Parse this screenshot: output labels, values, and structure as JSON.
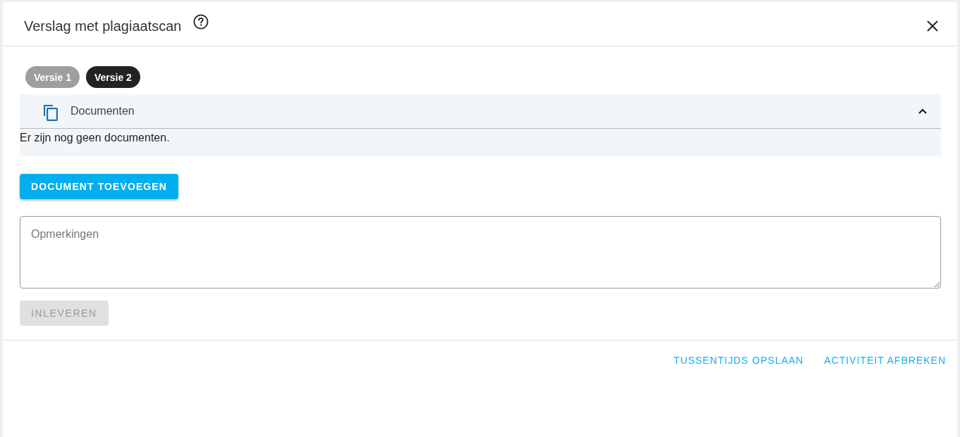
{
  "dialog": {
    "title": "Verslag met plagiaatscan"
  },
  "versions": [
    {
      "label": "Versie 1",
      "selected": false
    },
    {
      "label": "Versie 2",
      "selected": true
    }
  ],
  "documents_panel": {
    "title": "Documenten",
    "expanded": true,
    "empty_message": "Er zijn nog geen documenten."
  },
  "add_document_button": {
    "label": "DOCUMENT TOEVOEGEN"
  },
  "remarks_field": {
    "placeholder": "Opmerkingen"
  },
  "submit_button": {
    "label": "INLEVEREN",
    "disabled": true
  },
  "footer_actions": [
    "TUSSENTIJDS OPSLAAN",
    "ACTIVITEIT AFBREKEN"
  ]
}
